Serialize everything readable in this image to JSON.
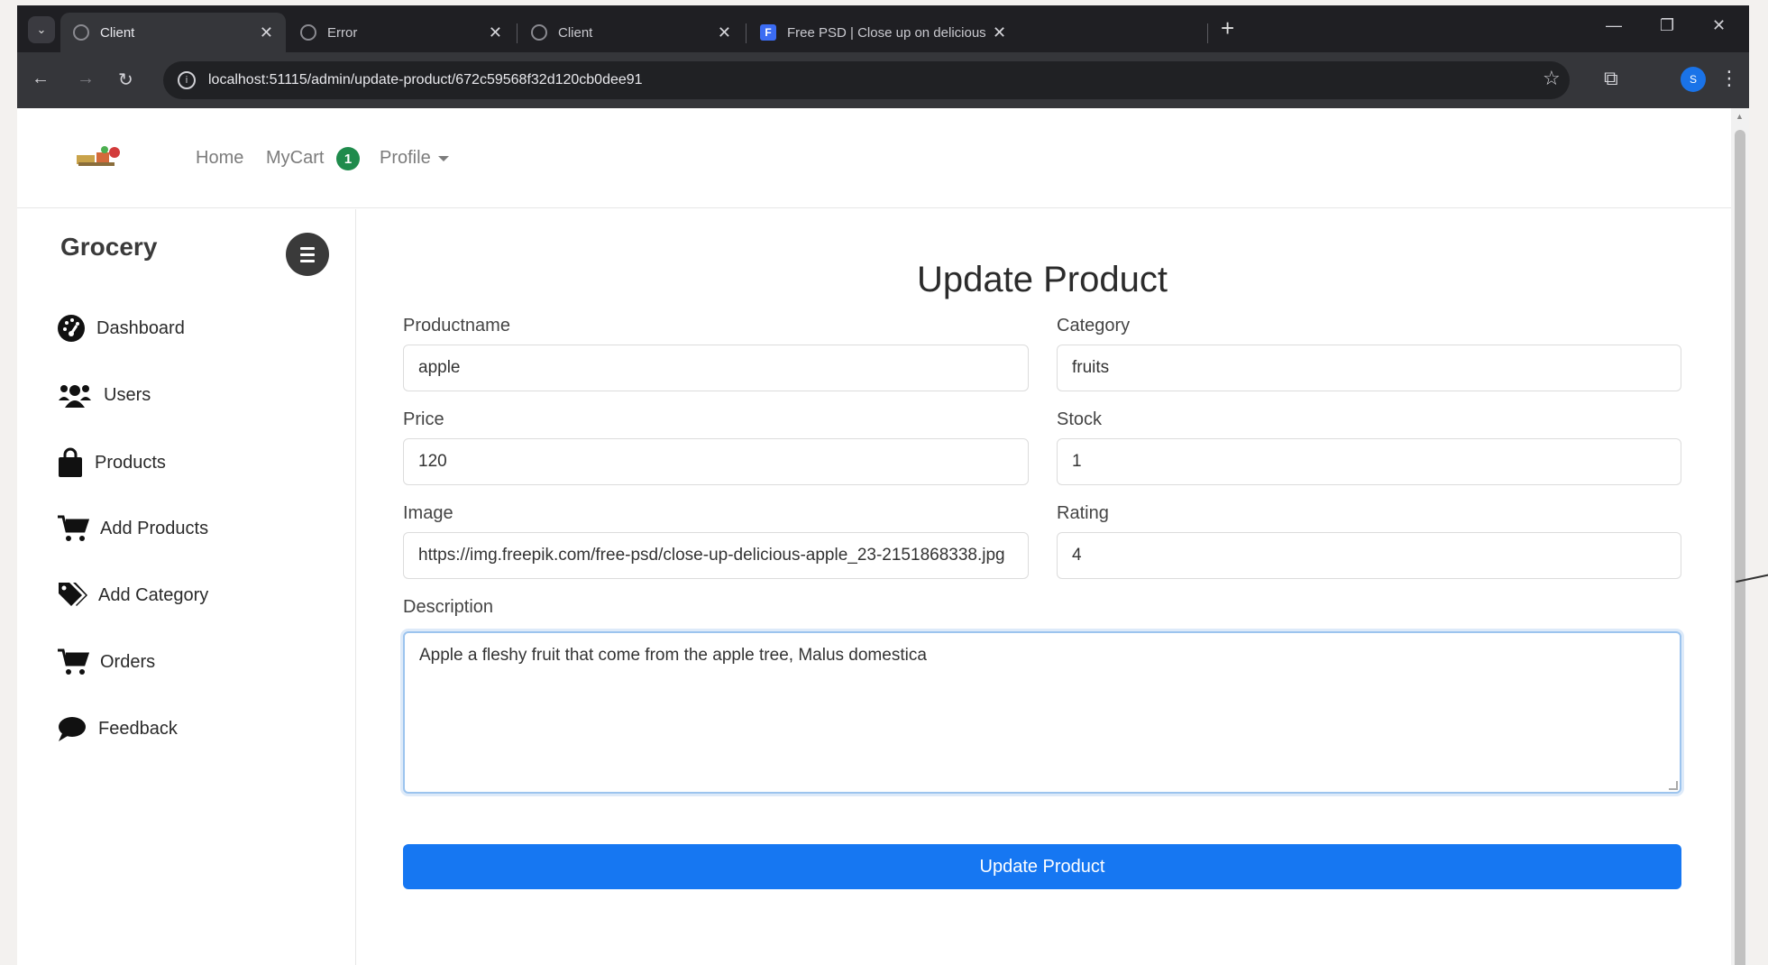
{
  "browser": {
    "tabs": [
      {
        "label": "Client",
        "active": true
      },
      {
        "label": "Error",
        "active": false
      },
      {
        "label": "Client",
        "active": false
      },
      {
        "label": "Free PSD | Close up on delicious a",
        "active": false
      }
    ],
    "favicon_fp": "F",
    "close_glyph": "✕",
    "new_tab_glyph": "+",
    "url": "localhost:51115/admin/update-product/672c59568f32d120cb0dee91",
    "profile_initial": "S"
  },
  "nav": {
    "home": "Home",
    "mycart": "MyCart",
    "cart_count": "1",
    "profile": "Profile"
  },
  "sidebar": {
    "brand": "Grocery",
    "items": [
      {
        "label": "Dashboard",
        "icon": "dashboard-icon"
      },
      {
        "label": "Users",
        "icon": "users-icon"
      },
      {
        "label": "Products",
        "icon": "shopping-bag-icon"
      },
      {
        "label": "Add Products",
        "icon": "cart-icon"
      },
      {
        "label": "Add Category",
        "icon": "tags-icon"
      },
      {
        "label": "Orders",
        "icon": "cart-icon"
      },
      {
        "label": "Feedback",
        "icon": "comment-icon"
      }
    ]
  },
  "form": {
    "title": "Update Product",
    "productname_label": "Productname",
    "productname_value": "apple",
    "category_label": "Category",
    "category_value": "fruits",
    "price_label": "Price",
    "price_value": "120",
    "stock_label": "Stock",
    "stock_value": "1",
    "image_label": "Image",
    "image_value": "https://img.freepik.com/free-psd/close-up-delicious-apple_23-2151868338.jpg",
    "rating_label": "Rating",
    "rating_value": "4",
    "description_label": "Description",
    "description_value": "Apple a fleshy fruit that come from the apple tree, Malus domestica",
    "submit_label": "Update Product"
  },
  "colors": {
    "primary": "#1677f2",
    "badge": "#1f8b4c",
    "chrome_dark": "#1f1f23"
  }
}
